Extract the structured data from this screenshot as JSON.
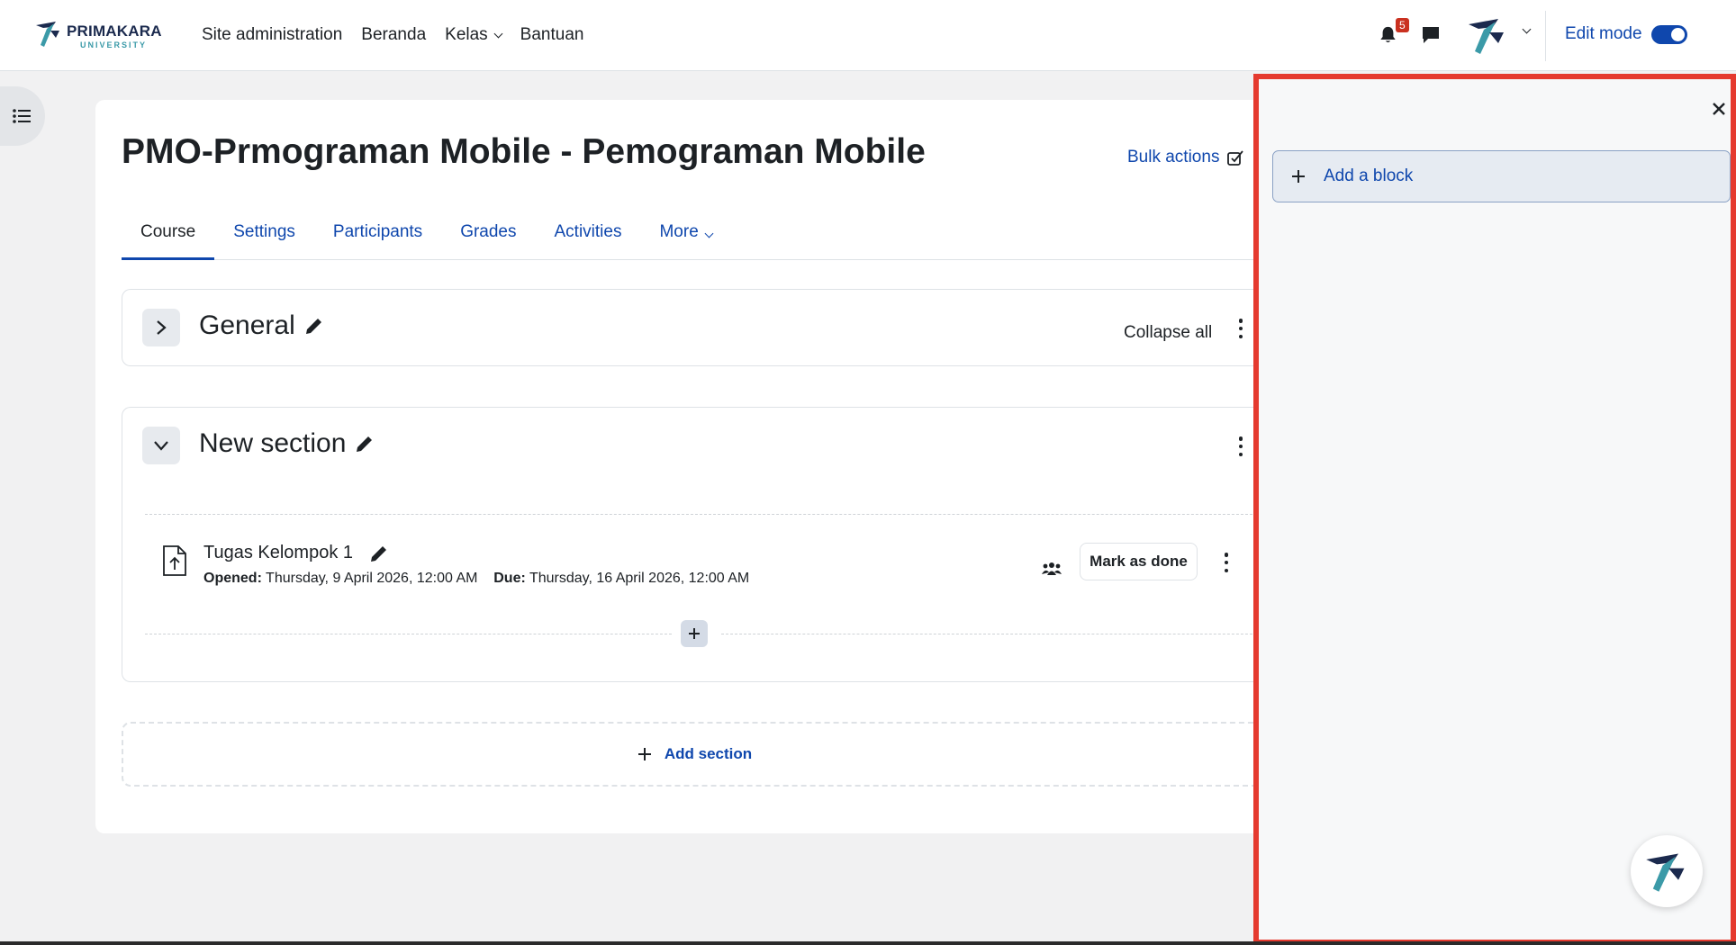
{
  "brand": {
    "name": "PRIMAKARA",
    "sub": "UNIVERSITY"
  },
  "nav": {
    "items": [
      "Site administration",
      "Beranda",
      "Kelas",
      "Bantuan"
    ],
    "notification_count": "5",
    "edit_mode_label": "Edit mode",
    "edit_mode_on": true
  },
  "course": {
    "title": "PMO-Prmograman Mobile - Pemograman Mobile",
    "bulk_actions": "Bulk actions",
    "tabs": [
      "Course",
      "Settings",
      "Participants",
      "Grades",
      "Activities",
      "More"
    ],
    "active_tab": "Course",
    "collapse_all": "Collapse all",
    "sections": [
      {
        "name": "General",
        "expanded": false
      },
      {
        "name": "New section",
        "expanded": true,
        "activities": [
          {
            "name": "Tugas Kelompok 1",
            "opened_label": "Opened:",
            "opened_value": "Thursday, 9 April 2026, 12:00 AM",
            "due_label": "Due:",
            "due_value": "Thursday, 16 April 2026, 12:00 AM",
            "mark_done": "Mark as done"
          }
        ]
      }
    ],
    "add_section": "Add section"
  },
  "block_drawer": {
    "add_block": "Add a block"
  },
  "colors": {
    "primary": "#0f47ad",
    "highlight_border": "#e53a2f",
    "badge": "#ca3120"
  },
  "icons": [
    "bell-icon",
    "chat-icon",
    "course-index-icon",
    "pencil-icon",
    "kebab-icon",
    "upload-file-icon",
    "group-icon",
    "plus-icon",
    "close-icon"
  ]
}
